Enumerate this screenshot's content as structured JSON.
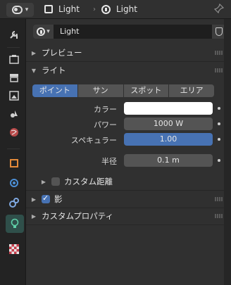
{
  "header": {
    "object_name": "Light",
    "data_name": "Light"
  },
  "datablock": {
    "name": "Light"
  },
  "panels": {
    "preview": "プレビュー",
    "light": "ライト",
    "custom_distance": "カスタム距離",
    "shadow": "影",
    "custom_props": "カスタムプロパティ"
  },
  "light_types": [
    "ポイント",
    "サン",
    "スポット",
    "エリア"
  ],
  "active_light_type": "ポイント",
  "properties": {
    "color_label": "カラー",
    "power_label": "パワー",
    "power_value": "1000 W",
    "specular_label": "スペキュラー",
    "specular_value": "1.00",
    "radius_label": "半径",
    "radius_value": "0.1 m"
  },
  "checkboxes": {
    "custom_distance": false,
    "shadow": true
  },
  "colors": {
    "accent": "#4772b3",
    "active_tab": "#2f4f4a",
    "light_color": "#ffffff"
  },
  "tab_icons": [
    "tool-icon",
    "render-icon",
    "output-icon",
    "view-layer-icon",
    "scene-icon",
    "world-icon",
    "object-icon",
    "physics-icon",
    "constraints-icon",
    "object-data-light-icon",
    "texture-icon"
  ]
}
